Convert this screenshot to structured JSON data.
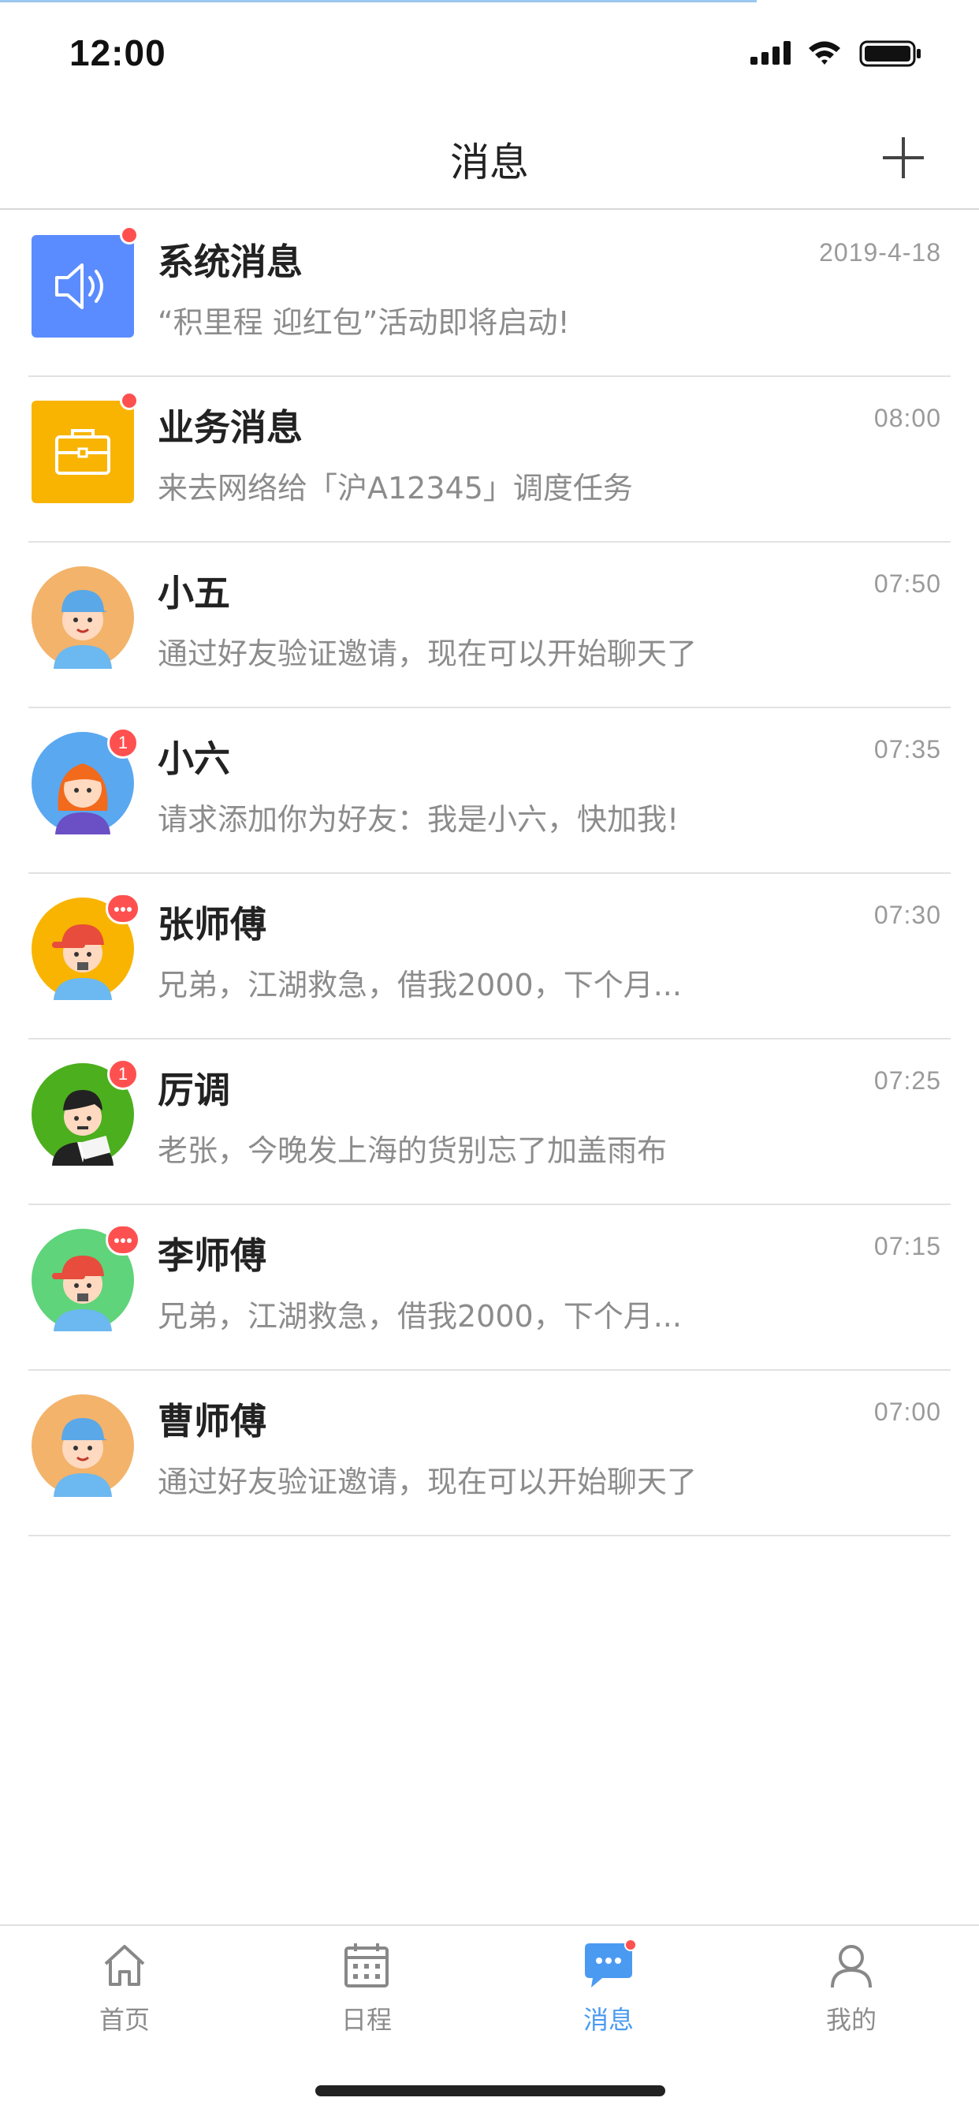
{
  "status_bar": {
    "time": "12:00"
  },
  "header": {
    "title": "消息"
  },
  "messages": [
    {
      "name": "系统消息",
      "preview": "“积里程 迎红包”活动即将启动!",
      "time": "2019-4-18"
    },
    {
      "name": "业务消息",
      "preview": "来去网络给「沪A12345」调度任务",
      "time": "08:00"
    },
    {
      "name": "小五",
      "preview": "通过好友验证邀请，现在可以开始聊天了",
      "time": "07:50"
    },
    {
      "name": "小六",
      "preview": "请求添加你为好友：我是小六，快加我!",
      "time": "07:35",
      "badge": "1"
    },
    {
      "name": "张师傅",
      "preview": "兄弟，江湖救急，借我2000，下个月...",
      "time": "07:30"
    },
    {
      "name": "厉调",
      "preview": "老张，今晚发上海的货别忘了加盖雨布",
      "time": "07:25",
      "badge": "1"
    },
    {
      "name": "李师傅",
      "preview": "兄弟，江湖救急，借我2000，下个月...",
      "time": "07:15"
    },
    {
      "name": "曹师傅",
      "preview": "通过好友验证邀请，现在可以开始聊天了",
      "time": "07:00"
    }
  ],
  "tabs": [
    {
      "label": "首页",
      "icon": "home-icon"
    },
    {
      "label": "日程",
      "icon": "calendar-icon"
    },
    {
      "label": "消息",
      "icon": "chat-icon",
      "active": true
    },
    {
      "label": "我的",
      "icon": "person-icon"
    }
  ],
  "colors": {
    "accent": "#4a9af2",
    "badge": "#ff5050",
    "system_icon_bg": "#5b8cff",
    "business_icon_bg": "#f8b400"
  }
}
